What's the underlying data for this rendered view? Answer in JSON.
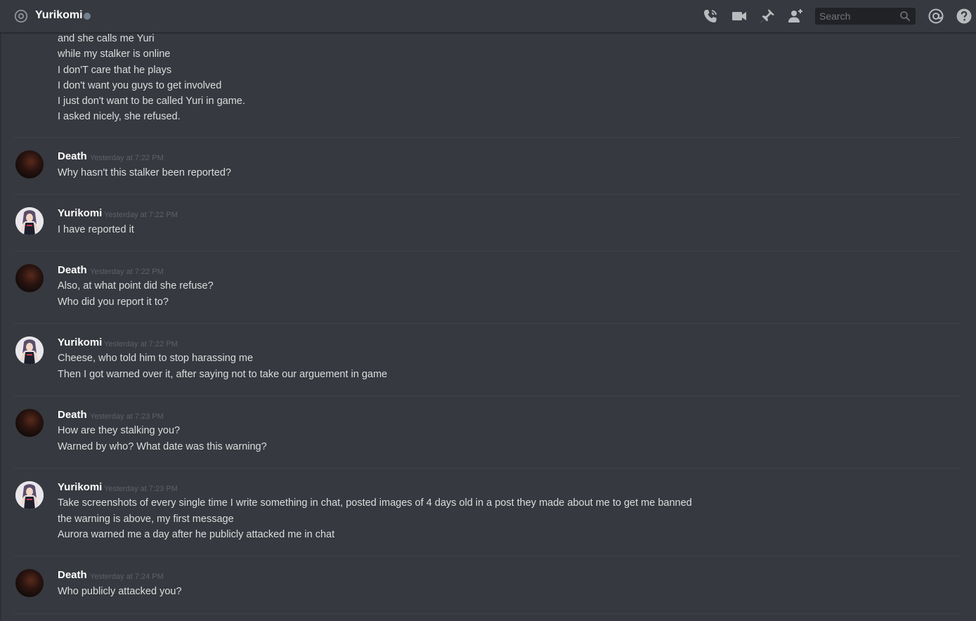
{
  "header": {
    "title": "Yurikomi",
    "search_placeholder": "Search"
  },
  "colors": {
    "background": "#36393f",
    "topbar": "#36393f",
    "search_bg": "#202225",
    "text": "#dcddde",
    "author": "#ffffff",
    "timestamp": "#5e6168",
    "status_offline": "#747f8d"
  },
  "icons": {
    "header": [
      "at-icon",
      "phone-call-icon",
      "video-camera-icon",
      "pin-icon",
      "add-friend-icon",
      "search-icon",
      "mention-icon",
      "help-icon"
    ]
  },
  "messages": [
    {
      "author": "",
      "timestamp": "",
      "avatar": "none",
      "lines": [
        "and she calls me Yuri",
        "while my stalker is online",
        "I don'T care that he plays",
        "I don't want you guys to get involved",
        "I just don't want to be called Yuri in game.",
        "I asked nicely, she refused."
      ]
    },
    {
      "author": "Death",
      "timestamp": "Yesterday at 7:22 PM",
      "avatar": "death",
      "lines": [
        "Why hasn't this stalker been reported?"
      ]
    },
    {
      "author": "Yurikomi",
      "timestamp": "Yesterday at 7:22 PM",
      "avatar": "yuri",
      "lines": [
        "I have reported it"
      ]
    },
    {
      "author": "Death",
      "timestamp": "Yesterday at 7:22 PM",
      "avatar": "death",
      "lines": [
        "Also, at what point did she refuse?",
        "Who did you report it to?"
      ]
    },
    {
      "author": "Yurikomi",
      "timestamp": "Yesterday at 7:22 PM",
      "avatar": "yuri",
      "lines": [
        "Cheese, who told him to stop harassing me",
        "Then I got warned over it, after saying not to take our arguement in game"
      ]
    },
    {
      "author": "Death",
      "timestamp": "Yesterday at 7:23 PM",
      "avatar": "death",
      "lines": [
        "How are they stalking you?",
        "Warned by who? What date was this warning?"
      ]
    },
    {
      "author": "Yurikomi",
      "timestamp": "Yesterday at 7:23 PM",
      "avatar": "yuri",
      "lines": [
        "Take screenshots of every single time I write something in chat, posted images of 4 days old in a post they made about me to get me banned",
        "the warning is above, my first message",
        "Aurora warned me a day after he publicly attacked me in chat"
      ]
    },
    {
      "author": "Death",
      "timestamp": "Yesterday at 7:24 PM",
      "avatar": "death",
      "lines": [
        "Who publicly attacked you?"
      ]
    }
  ]
}
